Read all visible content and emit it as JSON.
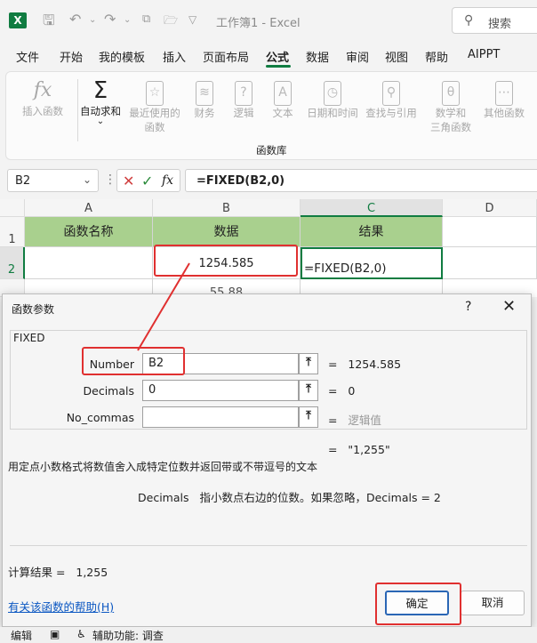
{
  "window": {
    "title": "工作簿1  -  Excel",
    "search_placeholder": "搜索",
    "logo_letter": "X"
  },
  "menu": [
    "文件",
    "开始",
    "我的模板",
    "插入",
    "页面布局",
    "公式",
    "数据",
    "审阅",
    "视图",
    "帮助",
    "AIPPT"
  ],
  "active_menu": "公式",
  "ribbon": {
    "insert_function": "插入函数",
    "autosum": "自动求和",
    "recent": [
      "最近使用的",
      "函数"
    ],
    "financial": "财务",
    "logical": "逻辑",
    "text": "文本",
    "datetime": "日期和时间",
    "lookup": "查找与引用",
    "math": [
      "数学和",
      "三角函数"
    ],
    "more": "其他函数",
    "group_label": "函数库"
  },
  "formula_bar": {
    "name_box": "B2",
    "formula": "=FIXED(B2,0)",
    "fx": "fx"
  },
  "sheet": {
    "columns": [
      "A",
      "B",
      "C",
      "D"
    ],
    "rows": [
      "1",
      "2"
    ],
    "headers": [
      "函数名称",
      "数据",
      "结果"
    ],
    "b2": "1254.585",
    "c2": "=FIXED(B2,0)",
    "b3_partial": "55.88"
  },
  "dialog": {
    "title": "函数参数",
    "help_glyph": "?",
    "function_name": "FIXED",
    "args": [
      {
        "label": "Number",
        "value": "B2",
        "result": "1254.585"
      },
      {
        "label": "Decimals",
        "value": "0",
        "result": "0"
      },
      {
        "label": "No_commas",
        "value": "",
        "result": "逻辑值"
      }
    ],
    "equals": "=",
    "formula_result": "\"1,255\"",
    "description": "用定点小数格式将数值舍入成特定位数并返回带或不带逗号的文本",
    "param_name": "Decimals",
    "param_desc": "指小数点右边的位数。如果忽略，Decimals = 2",
    "calc_label": "计算结果 =",
    "calc_value": "1,255",
    "help_link": "有关该函数的帮助(H)",
    "ok": "确定",
    "cancel": "取消"
  },
  "status": {
    "mode": "编辑",
    "accessibility": "辅助功能: 调查"
  }
}
